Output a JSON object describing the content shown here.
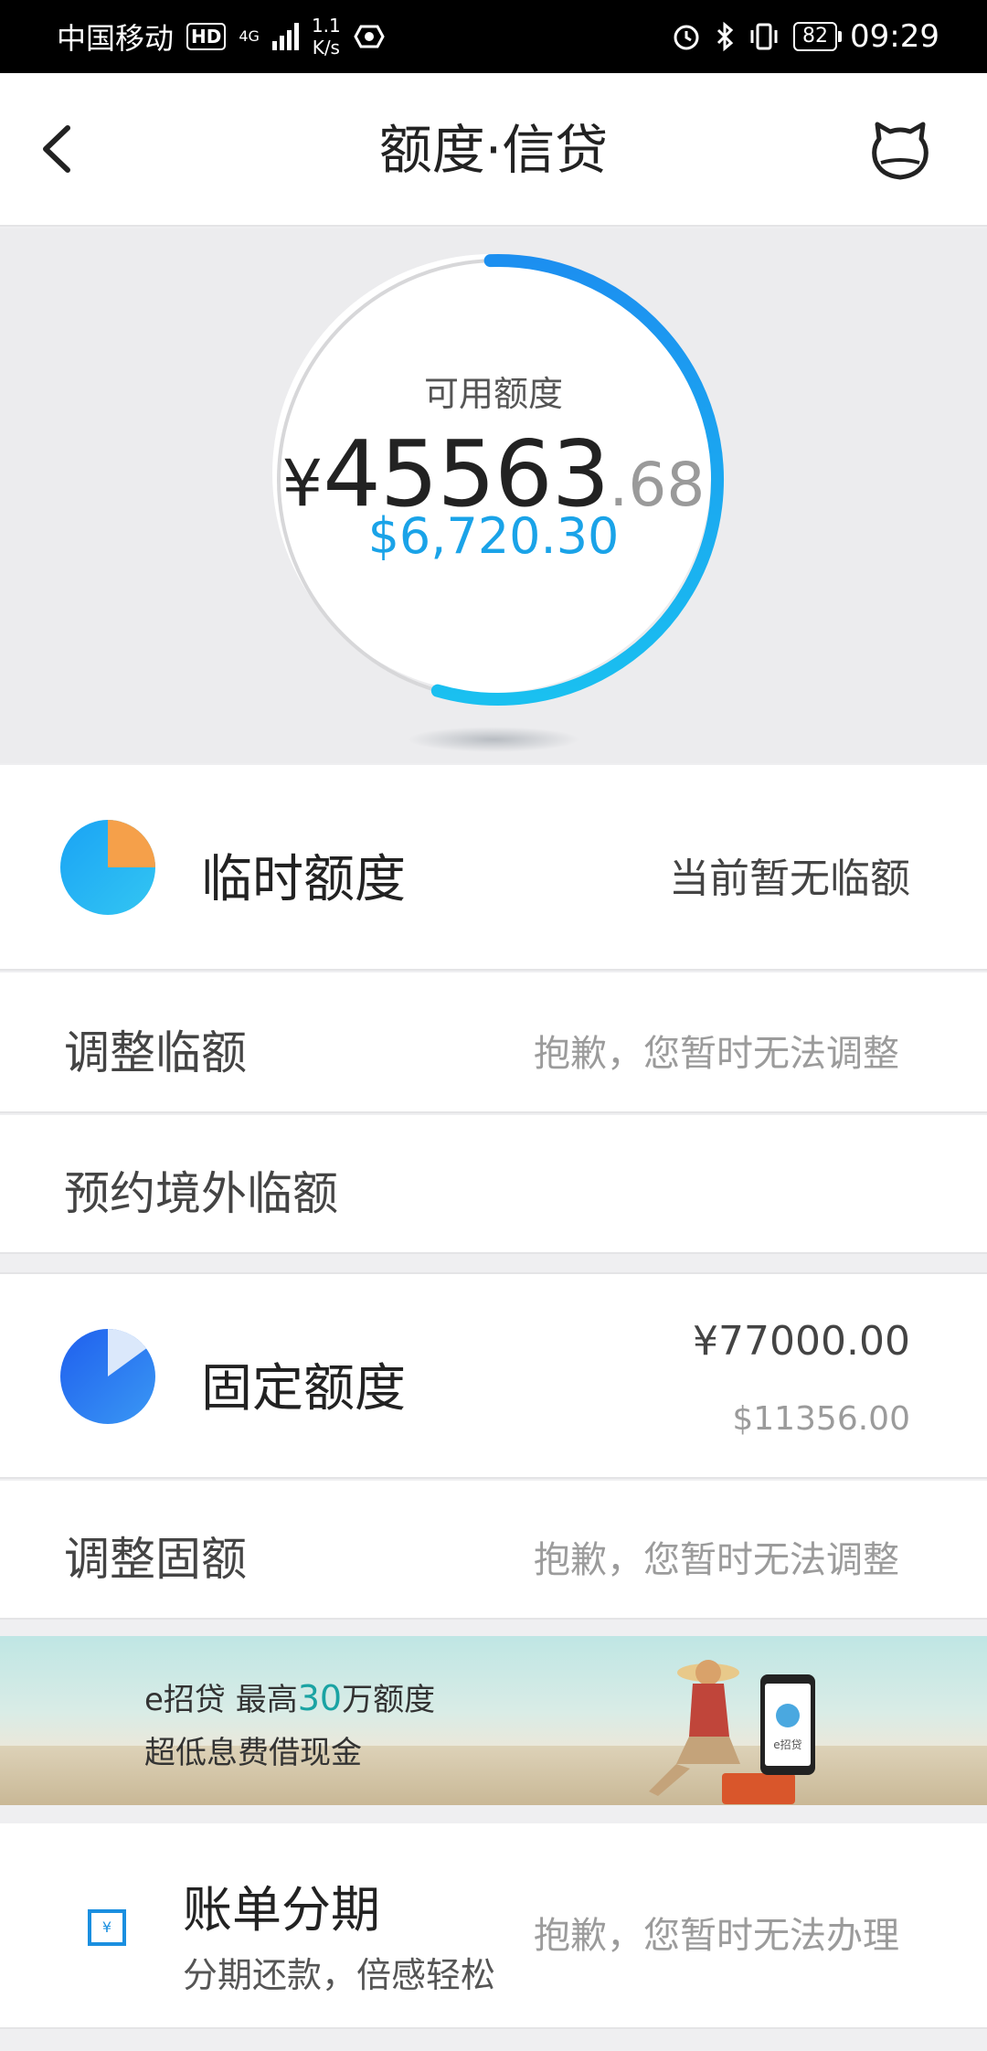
{
  "status_bar": {
    "carrier": "中国移动",
    "hd": "HD",
    "network": "4G",
    "speed": "1.1\nK/s",
    "battery": "82",
    "time": "09:29"
  },
  "header": {
    "title": "额度·信贷"
  },
  "available": {
    "label": "可用额度",
    "currency": "¥",
    "amount_int": "45563",
    "amount_dec": ".68",
    "usd": "$6,720.30",
    "ring_fraction": 0.55
  },
  "temporary": {
    "title": "临时额度",
    "value": "当前暂无临额",
    "pie_fraction": 0.25
  },
  "rows": {
    "adjust_temp_label": "调整临额",
    "adjust_temp_value": "抱歉，您暂时无法调整",
    "reserve_overseas_label": "预约境外临额"
  },
  "fixed": {
    "title": "固定额度",
    "value_cny": "¥77000.00",
    "value_usd": "$11356.00",
    "pie_fraction": 0.15,
    "adjust_label": "调整固额",
    "adjust_value": "抱歉，您暂时无法调整"
  },
  "banner": {
    "line1_prefix": "e招贷  最高",
    "line1_highlight": "30",
    "line1_suffix": "万额度",
    "line2": "超低息费借现金",
    "phone_text": "e招贷"
  },
  "installment": {
    "title": "账单分期",
    "subtitle": "分期还款，倍感轻松",
    "value": "抱歉，您暂时无法办理"
  },
  "colors": {
    "accent_blue": "#1aa3e8",
    "pie_orange": "#f5a04a",
    "pie_blue_fixed": "#2f6ff0"
  }
}
